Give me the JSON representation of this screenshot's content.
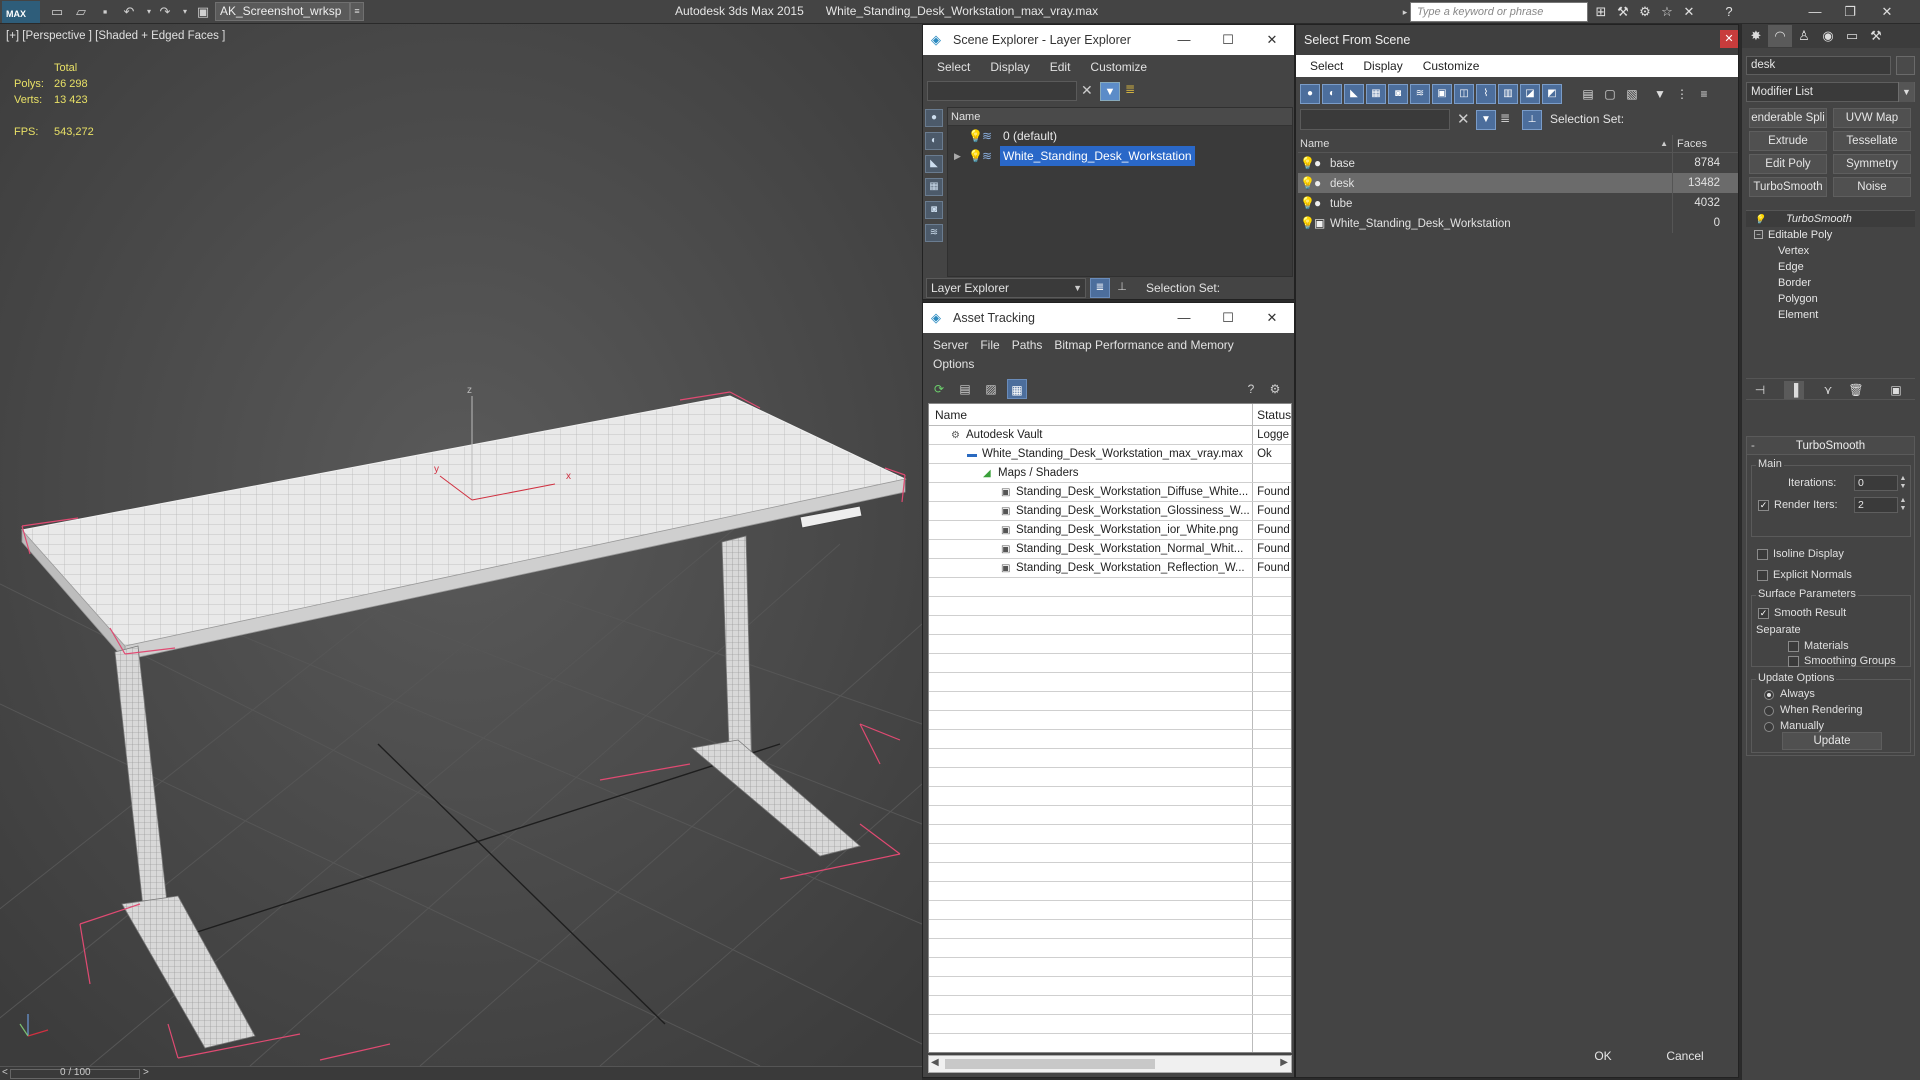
{
  "titlebar": {
    "logo_text": "MAX",
    "workspace": "AK_Screenshot_wrksp",
    "app_name": "Autodesk 3ds Max  2015",
    "file_name": "White_Standing_Desk_Workstation_max_vray.max",
    "search_placeholder": "Type a keyword or phrase"
  },
  "viewport": {
    "label": "[+] [Perspective ] [Shaded + Edged Faces ]",
    "stats": {
      "header": "Total",
      "polys_label": "Polys:",
      "polys_value": "26 298",
      "verts_label": "Verts:",
      "verts_value": "13 423",
      "fps_label": "FPS:",
      "fps_value": "543,272"
    },
    "axis_labels": {
      "x": "x",
      "y": "y",
      "z": "z"
    }
  },
  "timeline": {
    "prev": "<",
    "value": "0 / 100",
    "next": ">"
  },
  "scene_explorer": {
    "title": "Scene Explorer - Layer Explorer",
    "menu": [
      "Select",
      "Display",
      "Edit",
      "Customize"
    ],
    "column_name": "Name",
    "rows": [
      {
        "label": "0 (default)",
        "selected": false
      },
      {
        "label": "White_Standing_Desk_Workstation",
        "selected": true
      }
    ],
    "footer_dropdown": "Layer Explorer",
    "selection_set_label": "Selection Set:"
  },
  "asset_tracking": {
    "title": "Asset Tracking",
    "menu": [
      "Server",
      "File",
      "Paths",
      "Bitmap Performance and Memory"
    ],
    "menu2": [
      "Options"
    ],
    "col_name": "Name",
    "col_status": "Status",
    "rows": [
      {
        "name": "Autodesk Vault",
        "status": "Logge",
        "indent": 1
      },
      {
        "name": "White_Standing_Desk_Workstation_max_vray.max",
        "status": "Ok",
        "indent": 2
      },
      {
        "name": "Maps / Shaders",
        "status": "",
        "indent": 3
      },
      {
        "name": "Standing_Desk_Workstation_Diffuse_White...",
        "status": "Found",
        "indent": 4
      },
      {
        "name": "Standing_Desk_Workstation_Glossiness_W...",
        "status": "Found",
        "indent": 4
      },
      {
        "name": "Standing_Desk_Workstation_ior_White.png",
        "status": "Found",
        "indent": 4
      },
      {
        "name": "Standing_Desk_Workstation_Normal_Whit...",
        "status": "Found",
        "indent": 4
      },
      {
        "name": "Standing_Desk_Workstation_Reflection_W...",
        "status": "Found",
        "indent": 4
      }
    ]
  },
  "select_from_scene": {
    "title": "Select From Scene",
    "menu": [
      "Select",
      "Display",
      "Customize"
    ],
    "selection_set_label": "Selection Set:",
    "col_name": "Name",
    "col_faces": "Faces",
    "rows": [
      {
        "name": "base",
        "faces": "8784",
        "selected": false
      },
      {
        "name": "desk",
        "faces": "13482",
        "selected": true
      },
      {
        "name": "tube",
        "faces": "4032",
        "selected": false
      },
      {
        "name": "White_Standing_Desk_Workstation",
        "faces": "0",
        "selected": false
      }
    ],
    "ok_label": "OK",
    "cancel_label": "Cancel"
  },
  "command_panel": {
    "object_name": "desk",
    "modifier_list": "Modifier List",
    "mod_buttons": [
      "enderable Spli",
      "UVW Map",
      "Extrude",
      "Tessellate",
      "Edit Poly",
      "Symmetry",
      "TurboSmooth",
      "Noise"
    ],
    "stack": [
      {
        "label": "TurboSmooth",
        "type": "modifier"
      },
      {
        "label": "Editable Poly",
        "type": "base"
      },
      {
        "label": "Vertex",
        "type": "sub"
      },
      {
        "label": "Edge",
        "type": "sub"
      },
      {
        "label": "Border",
        "type": "sub"
      },
      {
        "label": "Polygon",
        "type": "sub"
      },
      {
        "label": "Element",
        "type": "sub"
      }
    ],
    "rollout_title": "TurboSmooth",
    "main_label": "Main",
    "iterations_label": "Iterations:",
    "iterations_value": "0",
    "render_iters_label": "Render Iters:",
    "render_iters_value": "2",
    "isoline_label": "Isoline Display",
    "explicit_normals_label": "Explicit Normals",
    "surface_params_label": "Surface Parameters",
    "smooth_result_label": "Smooth Result",
    "separate_label": "Separate",
    "materials_label": "Materials",
    "smoothing_groups_label": "Smoothing Groups",
    "update_options_label": "Update Options",
    "always_label": "Always",
    "when_rendering_label": "When Rendering",
    "manually_label": "Manually",
    "update_button": "Update"
  }
}
